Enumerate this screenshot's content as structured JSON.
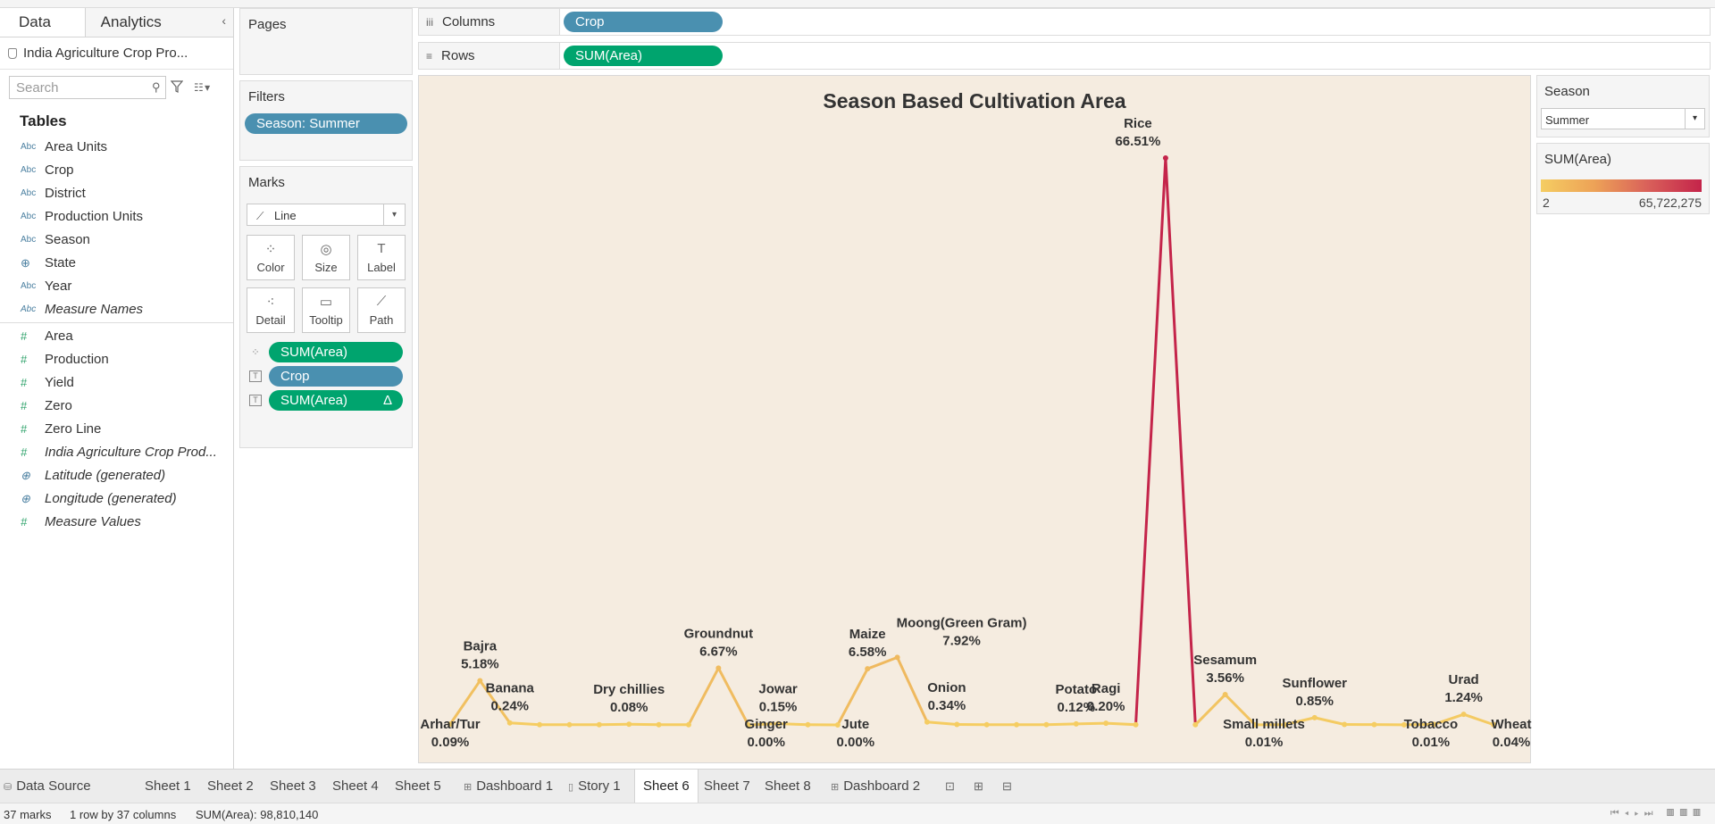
{
  "left_pane": {
    "tabs": [
      "Data",
      "Analytics"
    ],
    "datasource": "India Agriculture Crop Pro...",
    "search_placeholder": "Search",
    "tables_heading": "Tables",
    "dimensions": [
      {
        "name": "Area Units",
        "type": "Abc"
      },
      {
        "name": "Crop",
        "type": "Abc"
      },
      {
        "name": "District",
        "type": "Abc"
      },
      {
        "name": "Production Units",
        "type": "Abc"
      },
      {
        "name": "Season",
        "type": "Abc"
      },
      {
        "name": "State",
        "type": "geo"
      },
      {
        "name": "Year",
        "type": "Abc"
      },
      {
        "name": "Measure Names",
        "type": "Abc",
        "italic": true
      }
    ],
    "measures": [
      {
        "name": "Area",
        "type": "#"
      },
      {
        "name": "Production",
        "type": "#"
      },
      {
        "name": "Yield",
        "type": "#"
      },
      {
        "name": "Zero",
        "type": "#"
      },
      {
        "name": "Zero Line",
        "type": "#"
      },
      {
        "name": "India Agriculture Crop Prod...",
        "type": "#",
        "italic": true
      },
      {
        "name": "Latitude (generated)",
        "type": "geo",
        "italic": true
      },
      {
        "name": "Longitude (generated)",
        "type": "geo",
        "italic": true
      },
      {
        "name": "Measure Values",
        "type": "#",
        "italic": true
      }
    ]
  },
  "shelves": {
    "pages_label": "Pages",
    "filters_label": "Filters",
    "filter_pill": "Season: Summer",
    "marks_label": "Marks",
    "mark_type": "Line",
    "mark_buttons": [
      {
        "label": "Color",
        "icon": "color-icon"
      },
      {
        "label": "Size",
        "icon": "size-icon"
      },
      {
        "label": "Label",
        "icon": "label-icon"
      },
      {
        "label": "Detail",
        "icon": "detail-icon"
      },
      {
        "label": "Tooltip",
        "icon": "tooltip-icon"
      },
      {
        "label": "Path",
        "icon": "path-icon"
      }
    ],
    "mark_pills": [
      {
        "label": "SUM(Area)",
        "color": "green",
        "icon": "color-dots-icon",
        "delta": ""
      },
      {
        "label": "Crop",
        "color": "blue",
        "icon": "label-text-icon",
        "delta": ""
      },
      {
        "label": "SUM(Area)",
        "color": "green",
        "icon": "label-text-icon",
        "delta": "Δ"
      }
    ],
    "columns_label": "Columns",
    "columns_pill": "Crop",
    "rows_label": "Rows",
    "rows_pill": "SUM(Area)"
  },
  "chart_data": {
    "type": "line",
    "title": "Season Based Cultivation Area",
    "measure": "SUM(Area)",
    "total": 98810140,
    "color_range": [
      2,
      65722275
    ],
    "color_ramp": [
      "#f5cd62",
      "#c4244a"
    ],
    "points": [
      {
        "crop": "Arhar/Tur",
        "pct": 0.09,
        "label": "0.09%",
        "show": true
      },
      {
        "crop": "Bajra",
        "pct": 5.18,
        "label": "5.18%",
        "show": true
      },
      {
        "crop": "Banana",
        "pct": 0.24,
        "label": "0.24%",
        "show": true
      },
      {
        "crop": "",
        "pct": 0.02,
        "show": false
      },
      {
        "crop": "",
        "pct": 0.02,
        "show": false
      },
      {
        "crop": "",
        "pct": 0.03,
        "show": false
      },
      {
        "crop": "Dry chillies",
        "pct": 0.08,
        "label": "0.08%",
        "show": true
      },
      {
        "crop": "",
        "pct": 0.03,
        "show": false
      },
      {
        "crop": "",
        "pct": 0.02,
        "show": false
      },
      {
        "crop": "Groundnut",
        "pct": 6.67,
        "label": "6.67%",
        "show": true
      },
      {
        "crop": "Ginger",
        "pct": 0.0,
        "label": "0.00%",
        "show": true
      },
      {
        "crop": "Jowar",
        "pct": 0.15,
        "label": "0.15%",
        "show": true
      },
      {
        "crop": "",
        "pct": 0.02,
        "show": false
      },
      {
        "crop": "Jute",
        "pct": 0.0,
        "label": "0.00%",
        "show": true
      },
      {
        "crop": "Maize",
        "pct": 6.58,
        "label": "6.58%",
        "show": true
      },
      {
        "crop": "Moong(Green Gram)",
        "pct": 7.92,
        "label": "7.92%",
        "show": true
      },
      {
        "crop": "Onion",
        "pct": 0.34,
        "label": "0.34%",
        "show": true
      },
      {
        "crop": "",
        "pct": 0.05,
        "show": false
      },
      {
        "crop": "",
        "pct": 0.02,
        "show": false
      },
      {
        "crop": "",
        "pct": 0.02,
        "show": false
      },
      {
        "crop": "",
        "pct": 0.03,
        "show": false
      },
      {
        "crop": "Potato",
        "pct": 0.12,
        "label": "0.12%",
        "show": true
      },
      {
        "crop": "Ragi",
        "pct": 0.2,
        "label": "0.20%",
        "show": true
      },
      {
        "crop": "",
        "pct": 0.03,
        "show": false
      },
      {
        "crop": "Rice",
        "pct": 66.51,
        "label": "66.51%",
        "show": true
      },
      {
        "crop": "",
        "pct": 0.02,
        "show": false
      },
      {
        "crop": "Sesamum",
        "pct": 3.56,
        "label": "3.56%",
        "show": true
      },
      {
        "crop": "Small millets",
        "pct": 0.01,
        "label": "0.01%",
        "show": true
      },
      {
        "crop": "",
        "pct": 0.03,
        "show": false
      },
      {
        "crop": "Sunflower",
        "pct": 0.85,
        "label": "0.85%",
        "show": true
      },
      {
        "crop": "",
        "pct": 0.05,
        "show": false
      },
      {
        "crop": "",
        "pct": 0.04,
        "show": false
      },
      {
        "crop": "Tobacco",
        "pct": 0.01,
        "label": "0.01%",
        "show": true
      },
      {
        "crop": "",
        "pct": 0.06,
        "show": false
      },
      {
        "crop": "Urad",
        "pct": 1.24,
        "label": "1.24%",
        "show": true
      },
      {
        "crop": "Wheat",
        "pct": 0.04,
        "label": "0.04%",
        "show": true
      }
    ]
  },
  "right_pane": {
    "season_title": "Season",
    "season_value": "Summer",
    "legend_title": "SUM(Area)",
    "legend_min": "2",
    "legend_max": "65,722,275"
  },
  "sheet_tabs": [
    {
      "label": "Data Source",
      "icon": "datasource-icon"
    },
    {
      "label": "Sheet 1"
    },
    {
      "label": "Sheet 2"
    },
    {
      "label": "Sheet 3"
    },
    {
      "label": "Sheet 4"
    },
    {
      "label": "Sheet 5"
    },
    {
      "label": "Dashboard 1",
      "icon": "dashboard-icon"
    },
    {
      "label": "Story 1",
      "icon": "story-icon"
    },
    {
      "label": "Sheet 6",
      "active": true
    },
    {
      "label": "Sheet 7"
    },
    {
      "label": "Sheet 8"
    },
    {
      "label": "Dashboard 2",
      "icon": "dashboard-icon"
    }
  ],
  "status": {
    "marks": "37 marks",
    "dims": "1 row by 37 columns",
    "sum": "SUM(Area): 98,810,140"
  }
}
